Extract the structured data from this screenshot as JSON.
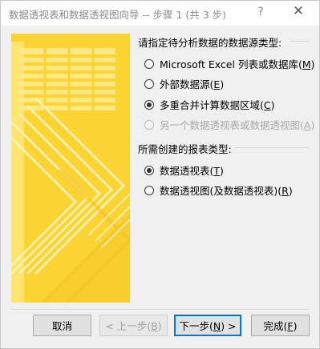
{
  "window": {
    "title": "数据透视表和数据透视图向导 -- 步骤 1 (共 3 步)",
    "help_glyph": "?",
    "close_glyph": "✕"
  },
  "datasource": {
    "heading": "请指定待分析数据的数据源类型:",
    "options": [
      {
        "label": "Microsoft Excel 列表或数据库",
        "hotkey": "M",
        "checked": false,
        "enabled": true
      },
      {
        "label": "外部数据源",
        "hotkey": "E",
        "checked": false,
        "enabled": true
      },
      {
        "label": "多重合并计算数据区域",
        "hotkey": "C",
        "checked": true,
        "enabled": true
      },
      {
        "label": "另一个数据透视表或数据透视图",
        "hotkey": "A",
        "checked": false,
        "enabled": false
      }
    ]
  },
  "report_type": {
    "heading": "所需创建的报表类型:",
    "options": [
      {
        "label": "数据透视表",
        "hotkey": "T",
        "checked": true,
        "enabled": true
      },
      {
        "label": "数据透视图(及数据透视表)",
        "hotkey": "R",
        "checked": false,
        "enabled": true
      }
    ]
  },
  "buttons": {
    "cancel": {
      "label": "取消"
    },
    "back": {
      "prefix": "< 上一步(",
      "hotkey": "B",
      "suffix": ")"
    },
    "next": {
      "prefix": "下一步(",
      "hotkey": "N",
      "suffix": ") >"
    },
    "finish": {
      "prefix": "完成(",
      "hotkey": "F",
      "suffix": ")"
    }
  },
  "colors": {
    "illustration_yellow": "#fbd434",
    "illustration_light": "#fde98a",
    "default_button_border": "#0078d7"
  }
}
